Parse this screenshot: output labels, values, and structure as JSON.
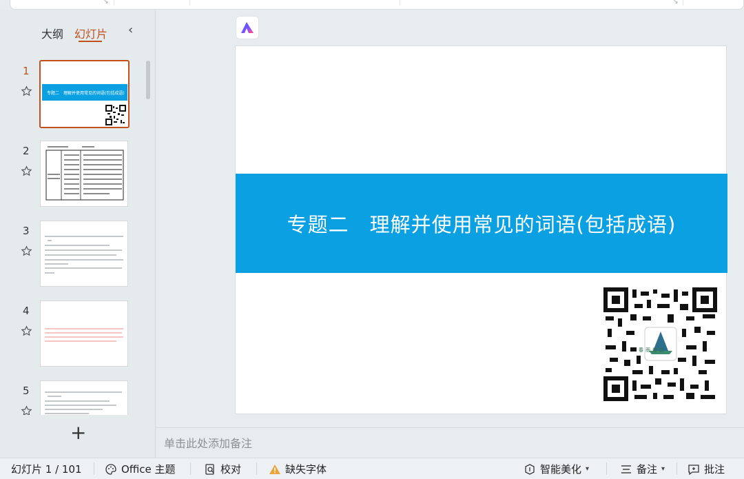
{
  "left_panel": {
    "tabs": {
      "outline": "大纲",
      "slides": "幻灯片"
    },
    "slides": [
      {
        "number": "1",
        "title": "专题二　理解并使用常见的词语(包括成语)"
      },
      {
        "number": "2"
      },
      {
        "number": "3"
      },
      {
        "number": "4"
      },
      {
        "number": "5"
      }
    ]
  },
  "main": {
    "slide_title": "专题二　理解并使用常见的词语(包括成语)",
    "qr_caption": "春雨墨韵",
    "notes_placeholder": "单击此处添加备注"
  },
  "statusbar": {
    "slide_counter": "幻灯片 1 / 101",
    "theme": "Office 主题",
    "proofread": "校对",
    "missing_fonts": "缺失字体",
    "smart_beautify": "智能美化",
    "notes": "备注",
    "comments": "批注"
  },
  "colors": {
    "accent": "#c0501e",
    "band": "#0aa0e2",
    "warning": "#e8a33a"
  }
}
